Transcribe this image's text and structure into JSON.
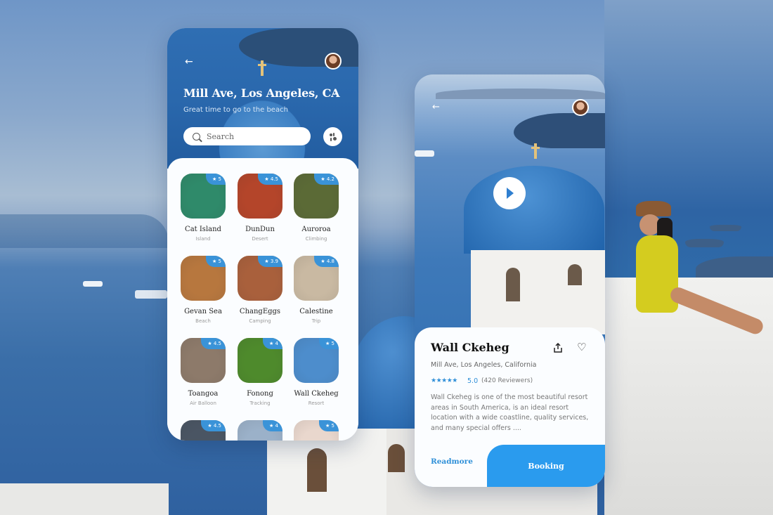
{
  "list_screen": {
    "title": "Mill Ave, Los Angeles, CA",
    "subtitle": "Great time to go to the beach",
    "search_placeholder": "Search",
    "places": [
      {
        "name": "Cat Island",
        "category": "Island",
        "rating": "5",
        "color": "#2f8a6a"
      },
      {
        "name": "DunDun",
        "category": "Desert",
        "rating": "4.5",
        "color": "#b4452a"
      },
      {
        "name": "Auroroa",
        "category": "Climbing",
        "rating": "4.2",
        "color": "#5b6a36"
      },
      {
        "name": "Gevan Sea",
        "category": "Beach",
        "rating": "5",
        "color": "#b7773e"
      },
      {
        "name": "ChangEggs",
        "category": "Camping",
        "rating": "3.9",
        "color": "#a9603c"
      },
      {
        "name": "Calestine",
        "category": "Trip",
        "rating": "4.8",
        "color": "#c9b9a2"
      },
      {
        "name": "Toangoa",
        "category": "Air Balloon",
        "rating": "4.5",
        "color": "#8d7a6a"
      },
      {
        "name": "Fonong",
        "category": "Tracking",
        "rating": "4",
        "color": "#4e8a2c"
      },
      {
        "name": "Wall Ckeheg",
        "category": "Resort",
        "rating": "5",
        "color": "#4d8dcc"
      },
      {
        "name": "",
        "category": "",
        "rating": "4.5",
        "color": "#4a5563"
      },
      {
        "name": "",
        "category": "",
        "rating": "4",
        "color": "#9bb1c9"
      },
      {
        "name": "",
        "category": "",
        "rating": "5",
        "color": "#e9d7cd"
      }
    ]
  },
  "detail_screen": {
    "title": "Wall Ckeheg",
    "address": "Mill Ave, Los Angeles, California",
    "stars": "★★★★★",
    "score": "5.0",
    "reviews": "(420 Reviewers)",
    "description": "Wall Ckeheg is one of the most beautiful resort areas in South America, is an ideal resort location with a wide coastline, quality services, and many special offers ....",
    "readmore_label": "Readmore",
    "booking_label": "Booking"
  },
  "icons": {
    "back": "←",
    "chevron": "⌄",
    "heart": "♡",
    "star": "★"
  },
  "colors": {
    "accent": "#2a9bee",
    "rating_badge": "#3a93d8"
  }
}
